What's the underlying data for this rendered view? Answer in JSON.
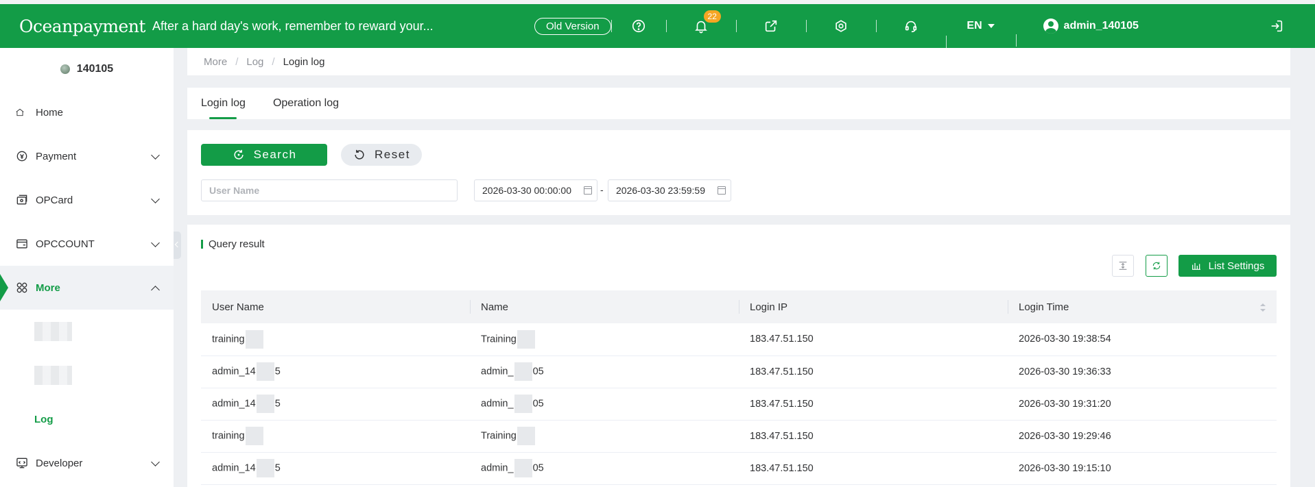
{
  "header": {
    "logo_text": "Oceanpayment",
    "slogan": "After a hard day's work, remember to reward your...",
    "old_version_label": "Old Version",
    "notification_count": "22",
    "language": "EN",
    "username": "admin_140105"
  },
  "sidebar": {
    "merchant_id": "140105",
    "items": [
      {
        "label": "Home",
        "icon": "home-icon"
      },
      {
        "label": "Payment",
        "icon": "payment-icon"
      },
      {
        "label": "OPCard",
        "icon": "card-icon"
      },
      {
        "label": "OPCCOUNT",
        "icon": "wallet-icon"
      },
      {
        "label": "More",
        "icon": "grid-icon"
      },
      {
        "label": "Developer",
        "icon": "developer-icon"
      }
    ],
    "sub_items": [
      {
        "label": ""
      },
      {
        "label": ""
      },
      {
        "label": "Log"
      }
    ]
  },
  "breadcrumb": {
    "items": [
      "More",
      "Log",
      "Login log"
    ],
    "separator": "/"
  },
  "tabs": [
    {
      "label": "Login log"
    },
    {
      "label": "Operation log"
    }
  ],
  "filters": {
    "search_label": "Search",
    "reset_label": "Reset",
    "user_name_placeholder": "User Name",
    "date_start": "2026-03-30 00:00:00",
    "date_end": "2026-03-30 23:59:59",
    "range_separator": "-"
  },
  "results": {
    "title": "Query result",
    "list_settings_label": "List Settings",
    "columns": [
      "User Name",
      "Name",
      "Login IP",
      "Login Time"
    ],
    "rows": [
      {
        "user_a": "training",
        "user_b": "",
        "name_a": "Training",
        "name_b": "",
        "ip": "183.47.51.150",
        "time": "2026-03-30 19:38:54"
      },
      {
        "user_a": "admin_14",
        "user_b": "5",
        "name_a": "admin_",
        "name_b": "05",
        "ip": "183.47.51.150",
        "time": "2026-03-30 19:36:33"
      },
      {
        "user_a": "admin_14",
        "user_b": "5",
        "name_a": "admin_",
        "name_b": "05",
        "ip": "183.47.51.150",
        "time": "2026-03-30 19:31:20"
      },
      {
        "user_a": "training",
        "user_b": "",
        "name_a": "Training",
        "name_b": "",
        "ip": "183.47.51.150",
        "time": "2026-03-30 19:29:46"
      },
      {
        "user_a": "admin_14",
        "user_b": "5",
        "name_a": "admin_",
        "name_b": "05",
        "ip": "183.47.51.150",
        "time": "2026-03-30 19:15:10"
      }
    ]
  },
  "colors": {
    "brand_green": "#139c47",
    "badge_orange": "#f5a623",
    "page_background": "#eef0f3"
  }
}
